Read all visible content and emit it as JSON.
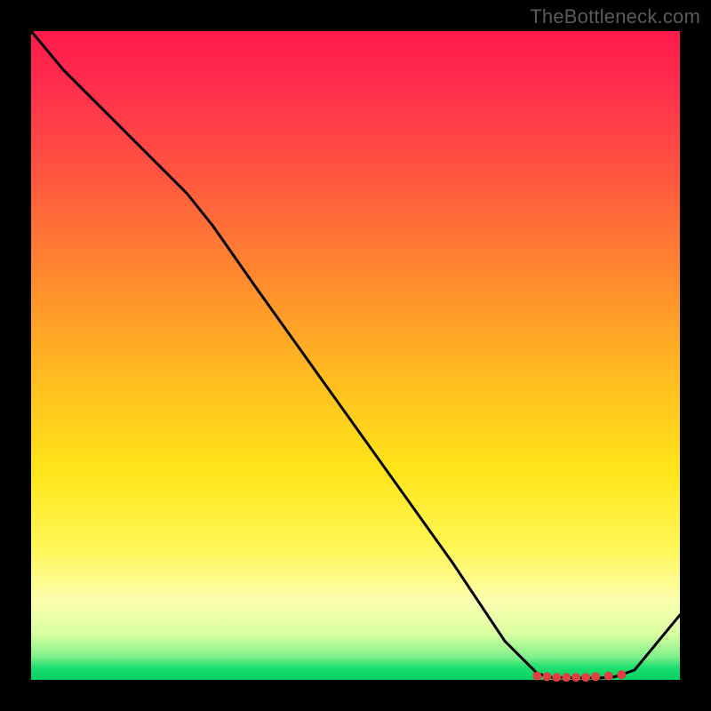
{
  "watermark": "TheBottleneck.com",
  "chart_data": {
    "type": "line",
    "title": "",
    "xlabel": "",
    "ylabel": "",
    "xlim": [
      0,
      100
    ],
    "ylim": [
      0,
      100
    ],
    "background_gradient": {
      "direction": "vertical",
      "stops": [
        {
          "pos": 0.0,
          "color": "#ff1a4b"
        },
        {
          "pos": 0.4,
          "color": "#ff8a2e"
        },
        {
          "pos": 0.68,
          "color": "#ffe61a"
        },
        {
          "pos": 0.88,
          "color": "#fbffb0"
        },
        {
          "pos": 1.0,
          "color": "#00d060"
        }
      ]
    },
    "series": [
      {
        "name": "bottleneck-curve",
        "color": "#000000",
        "x": [
          0,
          5,
          10,
          15,
          20,
          24,
          28,
          35,
          45,
          55,
          65,
          73,
          78,
          80,
          84,
          88,
          90,
          93,
          100
        ],
        "y": [
          100,
          94,
          89,
          84,
          79,
          75,
          70,
          60,
          46,
          32,
          18,
          6,
          1,
          0.4,
          0.3,
          0.3,
          0.5,
          1.5,
          10
        ]
      }
    ],
    "markers": {
      "name": "optimal-range",
      "color": "#e04040",
      "shape": "circle",
      "x": [
        78,
        79.5,
        81,
        82.5,
        84,
        85.5,
        87,
        89,
        91
      ],
      "y": [
        0.6,
        0.5,
        0.4,
        0.4,
        0.4,
        0.4,
        0.5,
        0.6,
        0.8
      ]
    }
  }
}
